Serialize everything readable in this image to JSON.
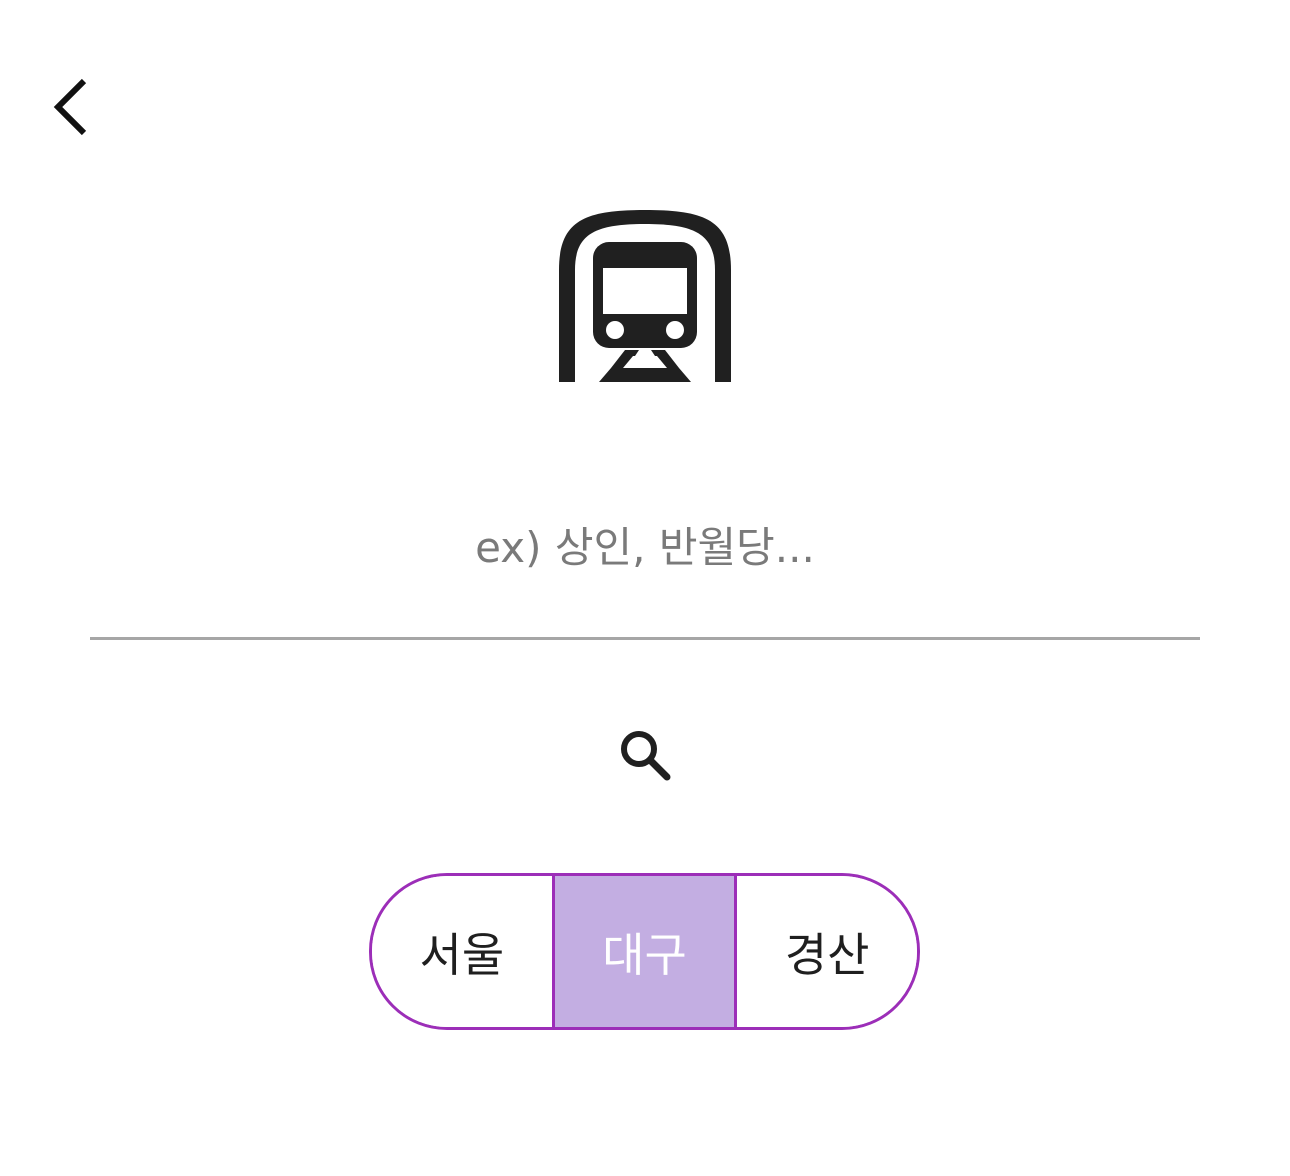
{
  "header": {
    "back_icon": "chevron-left-icon"
  },
  "hero": {
    "icon": "subway-icon"
  },
  "search": {
    "placeholder": "ex) 상인, 반월당...",
    "value": "",
    "search_icon": "search-icon"
  },
  "regions": {
    "options": [
      {
        "label": "서울",
        "selected": false
      },
      {
        "label": "대구",
        "selected": true
      },
      {
        "label": "경산",
        "selected": false
      }
    ],
    "selected_value": "대구"
  },
  "colors": {
    "accent_border": "#9c2eb8",
    "selected_fill": "#c3aee2",
    "selected_text": "#ffffff",
    "icon": "#202020",
    "underline": "#a6a6a6",
    "placeholder": "#7a7a7a"
  }
}
